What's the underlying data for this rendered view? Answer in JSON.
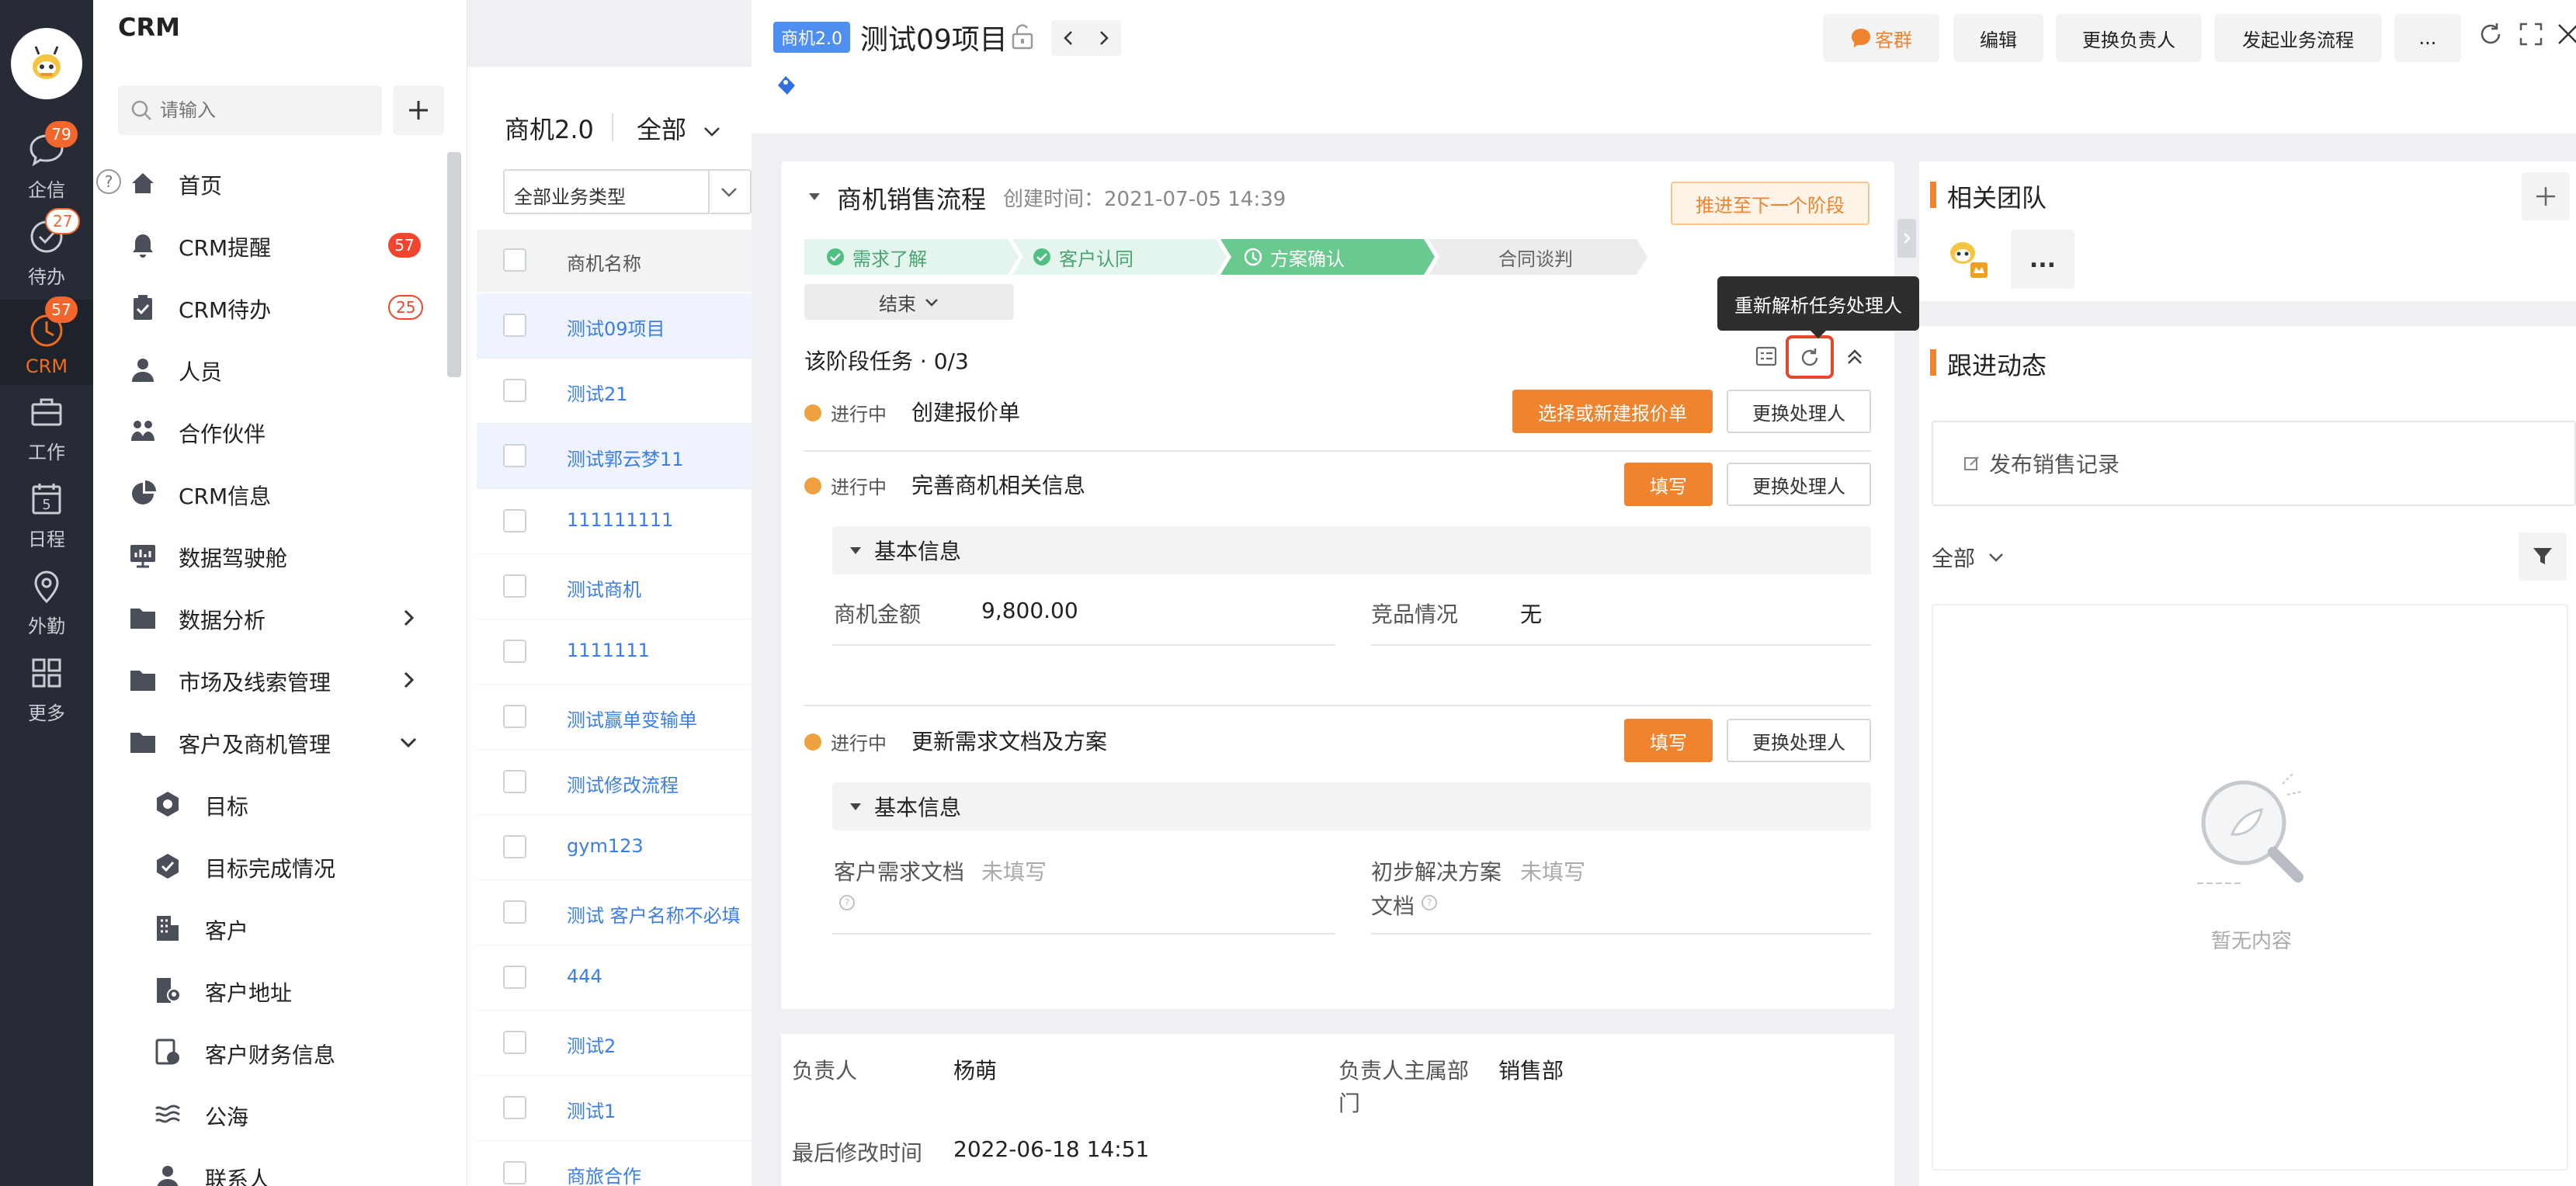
{
  "rail": {
    "items": [
      {
        "label": "企信",
        "badge": "79"
      },
      {
        "label": "待办",
        "badge": "27"
      },
      {
        "label": "CRM",
        "badge": "57"
      },
      {
        "label": "工作"
      },
      {
        "label": "日程",
        "day": "5"
      },
      {
        "label": "外勤"
      },
      {
        "label": "更多"
      }
    ]
  },
  "nav": {
    "title": "CRM",
    "search_placeholder": "请输入",
    "help": "?",
    "items": [
      {
        "label": "首页",
        "icon": "home-icon"
      },
      {
        "label": "CRM提醒",
        "badge": "57",
        "icon": "bell-icon"
      },
      {
        "label": "CRM待办",
        "badge": "25",
        "icon": "clipboard-icon"
      },
      {
        "label": "人员",
        "icon": "person-icon"
      },
      {
        "label": "合作伙伴",
        "icon": "partner-icon"
      },
      {
        "label": "CRM信息",
        "icon": "pie-icon"
      },
      {
        "label": "数据驾驶舱",
        "icon": "dashboard-icon"
      },
      {
        "label": "数据分析",
        "icon": "folder-icon"
      },
      {
        "label": "市场及线索管理",
        "icon": "folder-icon"
      },
      {
        "label": "客户及商机管理",
        "icon": "folder-icon"
      },
      {
        "label": "目标",
        "icon": "target-icon"
      },
      {
        "label": "目标完成情况",
        "icon": "shield-check-icon"
      },
      {
        "label": "客户",
        "icon": "building-icon"
      },
      {
        "label": "客户地址",
        "icon": "address-icon"
      },
      {
        "label": "客户财务信息",
        "icon": "finance-icon"
      },
      {
        "label": "公海",
        "icon": "wave-icon"
      },
      {
        "label": "联系人",
        "icon": "contact-icon"
      }
    ]
  },
  "list": {
    "title": "商机2.0",
    "filter": "全部",
    "type_select": "全部业务类型",
    "column": "商机名称",
    "rows": [
      "测试09项目",
      "测试21",
      "测试郭云梦11",
      "111111111",
      "测试商机",
      "1111111",
      "测试赢单变输单",
      "测试修改流程",
      "gym123",
      "测试 客户名称不必填",
      "444",
      "测试2",
      "测试1",
      "商旅合作"
    ]
  },
  "detail": {
    "tag": "商机2.0",
    "title": "测试09项目",
    "buttons": {
      "group": "客群",
      "edit": "编辑",
      "change_owner": "更换负责人",
      "start_flow": "发起业务流程",
      "more": "..."
    },
    "group_color": "#f0832d"
  },
  "stage": {
    "title": "商机销售流程",
    "created": "创建时间：2021-07-05 14:39",
    "advance": "推进至下一个阶段",
    "steps": [
      {
        "label": "需求了解",
        "state": "done"
      },
      {
        "label": "客户认同",
        "state": "done"
      },
      {
        "label": "方案确认",
        "state": "current"
      },
      {
        "label": "合同谈判",
        "state": "todo"
      }
    ],
    "end_label": "结束",
    "tasks_header": "该阶段任务 · 0/3",
    "tooltip": "重新解析任务处理人",
    "tasks": [
      {
        "status": "进行中",
        "name": "创建报价单",
        "action": "选择或新建报价单",
        "change": "更换处理人"
      },
      {
        "status": "进行中",
        "name": "完善商机相关信息",
        "action": "填写",
        "change": "更换处理人",
        "section": "基本信息",
        "fields": [
          {
            "label": "商机金额",
            "value": "9,800.00"
          },
          {
            "label": "竞品情况",
            "value": "无"
          }
        ]
      },
      {
        "status": "进行中",
        "name": "更新需求文档及方案",
        "action": "填写",
        "change": "更换处理人",
        "section": "基本信息",
        "fields": [
          {
            "label": "客户需求文档",
            "value": "未填写"
          },
          {
            "label": "初步解决方案",
            "label2": "文档",
            "value": "未填写"
          }
        ]
      }
    ]
  },
  "owner": {
    "owner_label": "负责人",
    "owner_value": "杨萌",
    "dept_label": "负责人主属部",
    "dept_label2": "门",
    "dept_value": "销售部",
    "modified_label": "最后修改时间",
    "modified_value": "2022-06-18 14:51"
  },
  "team": {
    "title": "相关团队",
    "more": "..."
  },
  "follow": {
    "title": "跟进动态",
    "publish": "发布销售记录",
    "filter": "全部",
    "empty": "暂无内容"
  }
}
